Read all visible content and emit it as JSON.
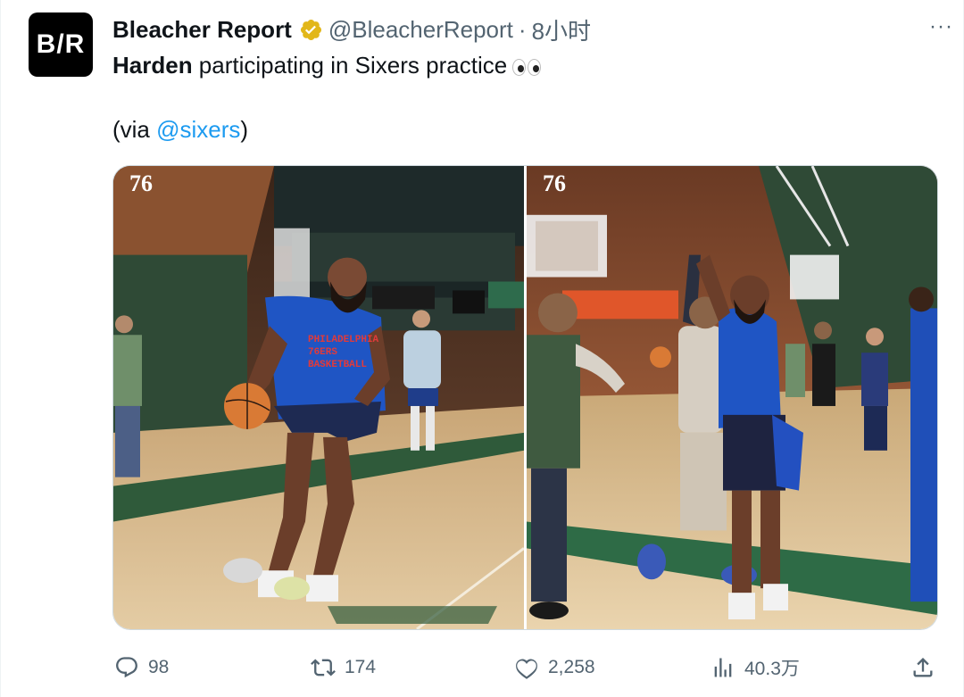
{
  "tweet": {
    "avatar_text": "B/R",
    "author_name": "Bleacher Report",
    "handle": "@BleacherReport",
    "separator": "·",
    "time": "8小时",
    "more": "···",
    "text_bold": "Harden",
    "text_rest": " participating in Sixers practice",
    "text_via_prefix": "(via ",
    "text_via_mention": "@sixers",
    "text_via_suffix": ")"
  },
  "media": {
    "photo1": {
      "logo": "76",
      "shirt_text": [
        "PHILADELPHIA",
        "76ERS",
        "BASKETBALL"
      ]
    },
    "photo2": {
      "logo": "76"
    }
  },
  "actions": {
    "replies": "98",
    "reposts": "174",
    "likes": "2,258",
    "views": "40.3万"
  },
  "icons": {
    "verified": "verified-badge-icon",
    "reply": "reply-icon",
    "repost": "repost-icon",
    "like": "heart-icon",
    "views": "views-icon",
    "share": "share-icon"
  },
  "colors": {
    "accent": "#1d9bf0",
    "verified_gold": "#e2b719",
    "muted": "#536471"
  }
}
